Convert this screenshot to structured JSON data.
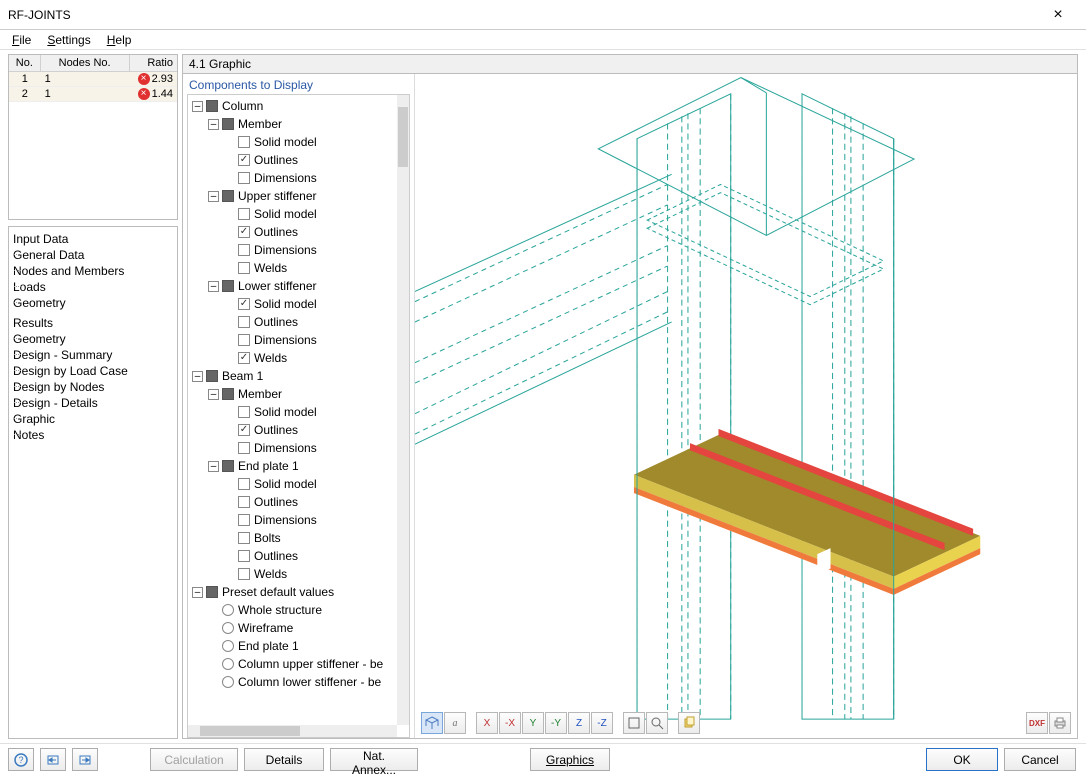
{
  "window": {
    "title": "RF-JOINTS",
    "close": "×"
  },
  "menu": {
    "file": "File",
    "settings": "Settings",
    "help": "Help"
  },
  "results_table": {
    "headers": {
      "no": "No.",
      "nodes": "Nodes No.",
      "ratio": "Ratio"
    },
    "rows": [
      {
        "no": "1",
        "nodes": "1",
        "ratio": "2.93"
      },
      {
        "no": "2",
        "nodes": "1",
        "ratio": "1.44"
      }
    ]
  },
  "navigator": {
    "input": {
      "title": "Input Data",
      "items": [
        "General Data",
        "Nodes and Members",
        "Loads",
        "Geometry"
      ]
    },
    "results": {
      "title": "Results",
      "items": [
        "Geometry",
        "Design - Summary",
        "Design by Load Case",
        "Design by Nodes",
        "Design - Details",
        "Graphic",
        "Notes"
      ]
    }
  },
  "graphic": {
    "header": "4.1 Graphic",
    "components_title": "Components to Display",
    "tree": {
      "column": {
        "label": "Column",
        "member": {
          "label": "Member",
          "solid": "Solid model",
          "outlines": "Outlines",
          "dimensions": "Dimensions"
        },
        "upper": {
          "label": "Upper stiffener",
          "solid": "Solid model",
          "outlines": "Outlines",
          "dimensions": "Dimensions",
          "welds": "Welds"
        },
        "lower": {
          "label": "Lower stiffener",
          "solid": "Solid model",
          "outlines": "Outlines",
          "dimensions": "Dimensions",
          "welds": "Welds"
        }
      },
      "beam1": {
        "label": "Beam 1",
        "member": {
          "label": "Member",
          "solid": "Solid model",
          "outlines": "Outlines",
          "dimensions": "Dimensions"
        },
        "endplate1": {
          "label": "End plate 1",
          "solid": "Solid model",
          "outlines": "Outlines",
          "dimensions": "Dimensions",
          "bolts": "Bolts",
          "outlines2": "Outlines",
          "welds": "Welds"
        }
      },
      "presets": {
        "label": "Preset default values",
        "whole": "Whole structure",
        "wire": "Wireframe",
        "endplate1": "End plate 1",
        "cus": "Column upper stiffener - be",
        "cls": "Column lower stiffener - be"
      }
    },
    "toolbar": {
      "iso": "iso",
      "abc": "abc",
      "xp": "X",
      "xm": "-X",
      "yp": "Y",
      "ym": "-Y",
      "zp": "Z",
      "zm": "-Z",
      "box": "box",
      "mag": "mag",
      "copy": "copy",
      "dxf": "DXF",
      "print": "print"
    }
  },
  "footer": {
    "help": "?",
    "calc": "Calculation",
    "details": "Details",
    "annex": "Nat. Annex...",
    "graphics": "Graphics",
    "ok": "OK",
    "cancel": "Cancel"
  }
}
